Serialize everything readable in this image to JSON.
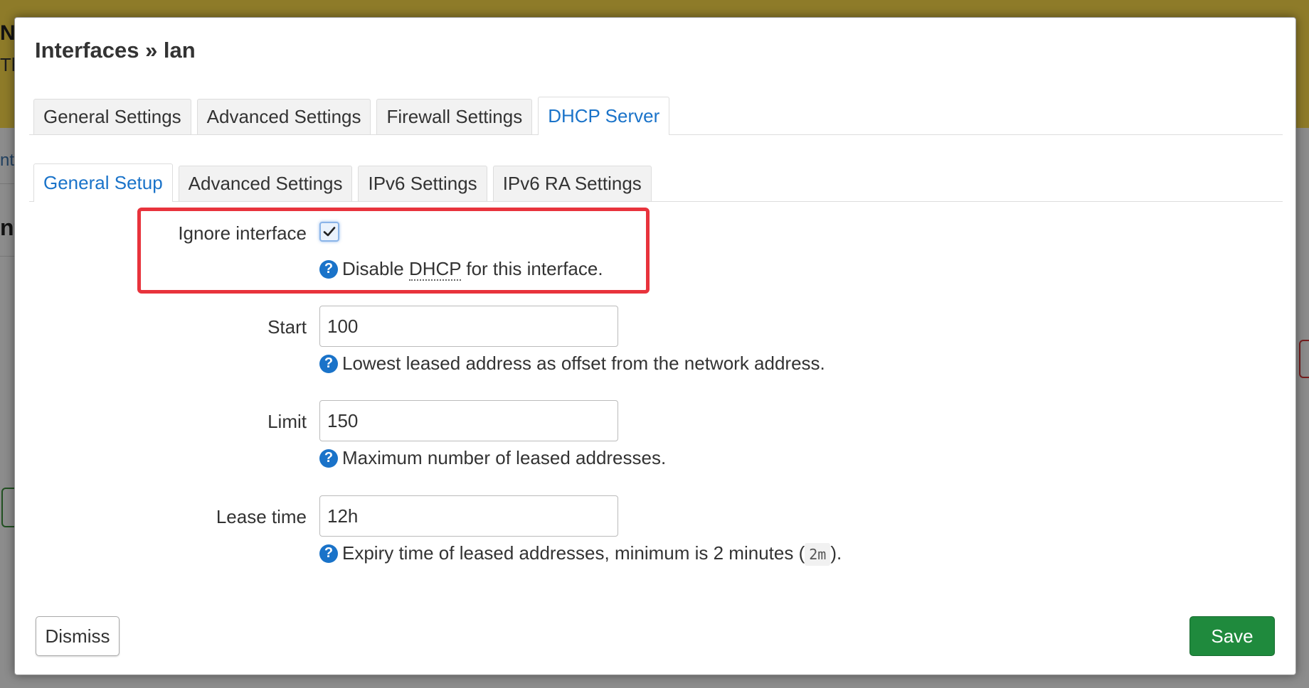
{
  "background": {
    "banner_letter": "N",
    "banner_letter2": "Th",
    "side_text": "nt",
    "side_heading": "nt"
  },
  "modal": {
    "title": "Interfaces » lan",
    "main_tabs": [
      {
        "label": "General Settings",
        "active": false
      },
      {
        "label": "Advanced Settings",
        "active": false
      },
      {
        "label": "Firewall Settings",
        "active": false
      },
      {
        "label": "DHCP Server",
        "active": true
      }
    ],
    "sub_tabs": [
      {
        "label": "General Setup",
        "active": true
      },
      {
        "label": "Advanced Settings",
        "active": false
      },
      {
        "label": "IPv6 Settings",
        "active": false
      },
      {
        "label": "IPv6 RA Settings",
        "active": false
      }
    ],
    "fields": {
      "ignore": {
        "label": "Ignore interface",
        "checked": true,
        "hint_pre": "Disable ",
        "hint_abbr": "DHCP",
        "hint_post": " for this interface."
      },
      "start": {
        "label": "Start",
        "value": "100",
        "hint": "Lowest leased address as offset from the network address."
      },
      "limit": {
        "label": "Limit",
        "value": "150",
        "hint": "Maximum number of leased addresses."
      },
      "leasetime": {
        "label": "Lease time",
        "value": "12h",
        "hint_pre": "Expiry time of leased addresses, minimum is 2 minutes (",
        "hint_code": "2m",
        "hint_post": ")."
      }
    },
    "buttons": {
      "dismiss": "Dismiss",
      "save": "Save"
    },
    "help_glyph": "?"
  },
  "colors": {
    "accent": "#1a73c9",
    "save": "#1f8a3d",
    "highlight": "#e8333c",
    "banner": "#f5d547"
  },
  "icons": {
    "checkmark": "check-icon",
    "help": "help-circle-icon"
  }
}
